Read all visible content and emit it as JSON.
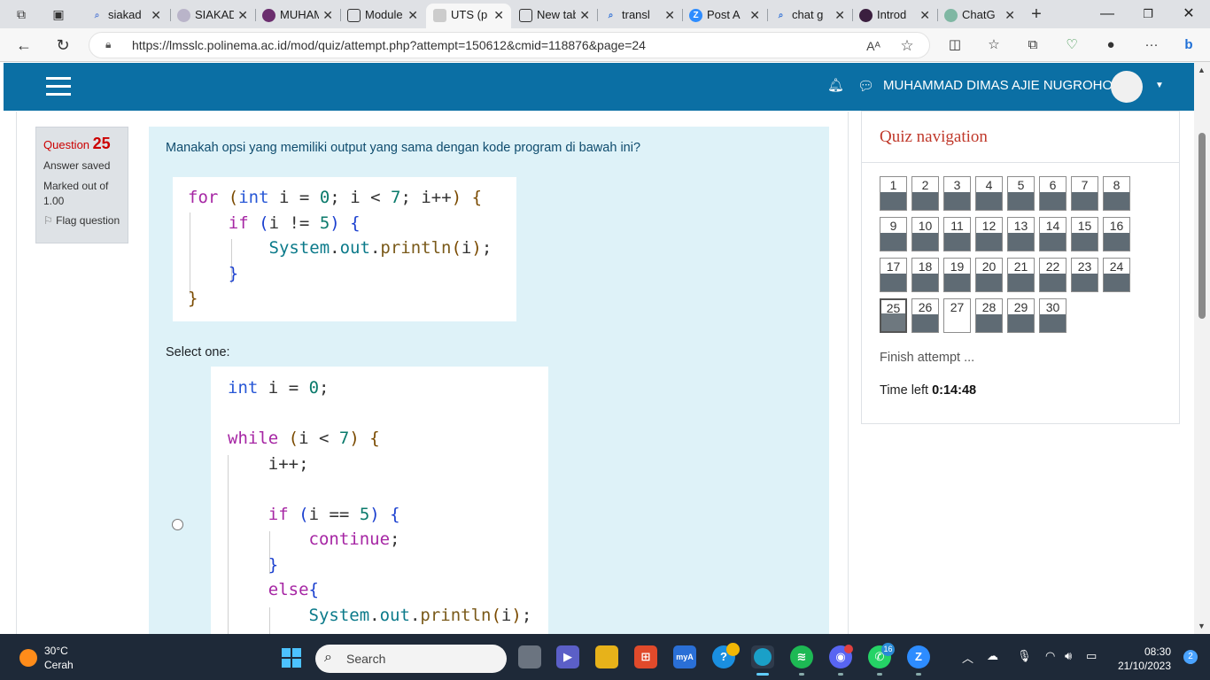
{
  "browser": {
    "tabs": [
      {
        "label": "siakad",
        "icon": "search-icon"
      },
      {
        "label": "SIAKAD",
        "icon": "polinema-logo-icon"
      },
      {
        "label": "MUHAMMAD",
        "icon": "polinema-logo-icon"
      },
      {
        "label": "Module",
        "icon": "document-icon"
      },
      {
        "label": "UTS (p",
        "icon": "moodle-icon"
      },
      {
        "label": "New tab",
        "icon": "new-tab-icon"
      },
      {
        "label": "transl",
        "icon": "search-icon"
      },
      {
        "label": "Post A",
        "icon": "zoom-icon"
      },
      {
        "label": "chat g",
        "icon": "search-icon"
      },
      {
        "label": "Introd",
        "icon": "openai-icon"
      },
      {
        "label": "ChatG",
        "icon": "chatgpt-icon"
      }
    ],
    "active_tab_index": 4,
    "url": "https://lmsslc.polinema.ac.id/mod/quiz/attempt.php?attempt=150612&cmid=118876&page=24"
  },
  "moodle": {
    "user_name": "MUHAMMAD DIMAS AJIE NUGROHO",
    "question_info": {
      "label": "Question",
      "number": "25",
      "state": "Answer saved",
      "marks": "Marked out of 1.00",
      "flag": "Flag question"
    },
    "question_text": "Manakah opsi yang memiliki output yang sama dengan kode program di bawah ini?",
    "select_one": "Select one:",
    "quiz_nav": {
      "title": "Quiz navigation",
      "questions": [
        "1",
        "2",
        "3",
        "4",
        "5",
        "6",
        "7",
        "8",
        "9",
        "10",
        "11",
        "12",
        "13",
        "14",
        "15",
        "16",
        "17",
        "18",
        "19",
        "20",
        "21",
        "22",
        "23",
        "24",
        "25",
        "26",
        "27",
        "28",
        "29",
        "30"
      ],
      "current": "25",
      "unanswered": [
        "27"
      ],
      "finish": "Finish attempt ...",
      "time_label": "Time left",
      "time_value": "0:14:48"
    }
  },
  "taskbar": {
    "temperature": "30°C",
    "condition": "Cerah",
    "search_placeholder": "Search",
    "time": "08:30",
    "date": "21/10/2023",
    "notification_count": "2",
    "whatsapp_badge": "16"
  }
}
